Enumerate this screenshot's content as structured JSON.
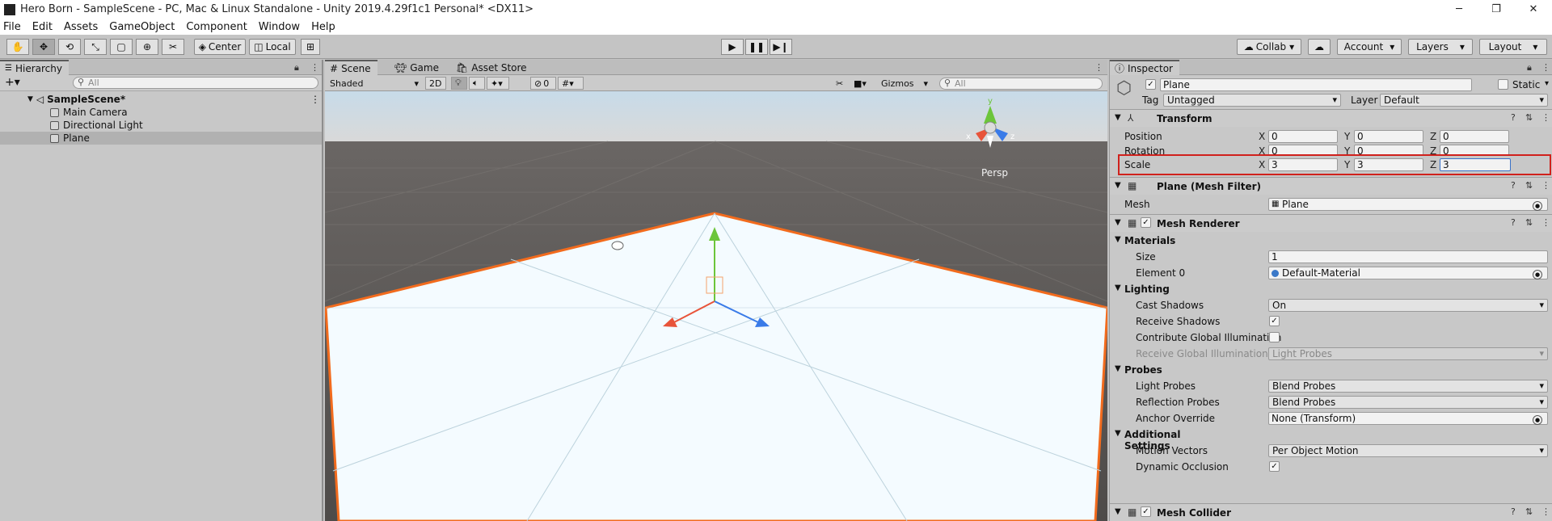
{
  "window": {
    "title": "Hero Born - SampleScene - PC, Mac & Linux Standalone - Unity 2019.4.29f1c1 Personal* <DX11>",
    "minimize": "─",
    "maximize": "❐",
    "close": "✕"
  },
  "menu": [
    "File",
    "Edit",
    "Assets",
    "GameObject",
    "Component",
    "Window",
    "Help"
  ],
  "toolbar": {
    "pivot_label": "Center",
    "space_label": "Local",
    "collab_label": "Collab",
    "account_label": "Account",
    "layers_label": "Layers",
    "layout_label": "Layout"
  },
  "hierarchy": {
    "tab_label": "Hierarchy",
    "search_placeholder": "All",
    "scene_name": "SampleScene*",
    "items": [
      "Main Camera",
      "Directional Light",
      "Plane"
    ],
    "selected_item": "Plane"
  },
  "scene": {
    "tabs": [
      "Scene",
      "Game",
      "Asset Store"
    ],
    "active_tab": "Scene",
    "shading_mode": "Shaded",
    "mode_2d": "2D",
    "hidden_count": "0",
    "gizmos_label": "Gizmos",
    "search_placeholder": "All",
    "projection_label": "Persp",
    "axis_labels": {
      "x": "x",
      "y": "y",
      "z": "z"
    },
    "colors": {
      "selection_outline": "#f26b1d",
      "sky": "#c7dbe9",
      "ground": "#6d6865",
      "plane": "#f4fbff"
    }
  },
  "inspector": {
    "tab_label": "Inspector",
    "object_name": "Plane",
    "object_active": true,
    "static_label": "Static",
    "tag_label": "Tag",
    "tag_value": "Untagged",
    "layer_label": "Layer",
    "layer_value": "Default",
    "transform": {
      "title": "Transform",
      "position_label": "Position",
      "rotation_label": "Rotation",
      "scale_label": "Scale",
      "position": {
        "x": "0",
        "y": "0",
        "z": "0"
      },
      "rotation": {
        "x": "0",
        "y": "0",
        "z": "0"
      },
      "scale": {
        "x": "3",
        "y": "3",
        "z": "3"
      },
      "axis_x": "X",
      "axis_y": "Y",
      "axis_z": "Z",
      "highlight_color": "#d0211c"
    },
    "mesh_filter": {
      "title": "Plane (Mesh Filter)",
      "mesh_label": "Mesh",
      "mesh_value": "Plane"
    },
    "mesh_renderer": {
      "title": "Mesh Renderer",
      "materials_label": "Materials",
      "size_label": "Size",
      "size_value": "1",
      "element0_label": "Element 0",
      "element0_value": "Default-Material",
      "lighting_label": "Lighting",
      "cast_shadows_label": "Cast Shadows",
      "cast_shadows_value": "On",
      "receive_shadows_label": "Receive Shadows",
      "receive_shadows": true,
      "contribute_gi_label": "Contribute Global Illumination",
      "contribute_gi": false,
      "receive_gi_label": "Receive Global Illumination",
      "receive_gi_value": "Light Probes",
      "probes_label": "Probes",
      "light_probes_label": "Light Probes",
      "light_probes_value": "Blend Probes",
      "reflection_probes_label": "Reflection Probes",
      "reflection_probes_value": "Blend Probes",
      "anchor_override_label": "Anchor Override",
      "anchor_override_value": "None (Transform)",
      "additional_label": "Additional Settings",
      "motion_vectors_label": "Motion Vectors",
      "motion_vectors_value": "Per Object Motion",
      "dynamic_occlusion_label": "Dynamic Occlusion",
      "dynamic_occlusion": true
    },
    "mesh_collider": {
      "title": "Mesh Collider"
    }
  }
}
